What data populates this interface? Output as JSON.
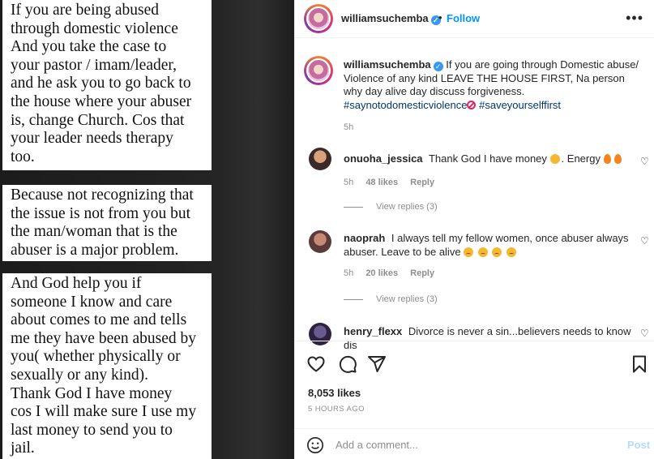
{
  "media": {
    "note1": "If you are being abused\nthrough domestic violence\nAnd you take the case to\nyour pastor / imam/leader,\nand he ask you to go back to\nthe house where your abuser\nis, change Church. Cos that\nyour leader needs therapy\ntoo.",
    "note2": "Because not recognizing that\nthe issue is not from you but\nthe man/woman that is the\nabuser is a major problem.",
    "note3": "And God help you if\nsomeone I know and care\nabout comes to me and tells\nme they have been abused by\nyou( whether physically or\nsexually or any kind).\nThank God I have money\ncos I will make sure I use my\nlast money to send you to\njail."
  },
  "header": {
    "username": "williamsuchemba",
    "dot": "•",
    "follow_label": "Follow",
    "more_icon": "more-horizontal-icon"
  },
  "caption": {
    "username": "williamsuchemba",
    "text": "If you are going through Domestic abuse/ Violence of any kind LEAVE THE HOUSE FIRST, Na person why day alive day discuss forgiveness.",
    "tag1": "#saynotodomesticviolence",
    "tag2": "#saveyourselffirst",
    "time": "5h"
  },
  "comments": [
    {
      "username": "onuoha_jessica",
      "text": "Thank God I have money",
      "after_emoji": ". Energy",
      "time": "5h",
      "likes": "48 likes",
      "reply": "Reply",
      "view_replies": "View replies (3)"
    },
    {
      "username": "naoprah",
      "text": "I always tell my fellow women, once abuser always abuser. Leave to be alive",
      "time": "5h",
      "likes": "20 likes",
      "reply": "Reply",
      "view_replies": "View replies (3)"
    },
    {
      "username": "henry_flexx",
      "text": "Divorce is never a sin...believers needs to know dis"
    }
  ],
  "actions": {
    "likes": "8,053 likes",
    "time_ago": "5 HOURS AGO"
  },
  "add_comment": {
    "placeholder": "Add a comment...",
    "post_label": "Post"
  },
  "colors": {
    "accent": "#0095f6",
    "hashtag": "#00376b",
    "muted": "#8e8e8e"
  }
}
